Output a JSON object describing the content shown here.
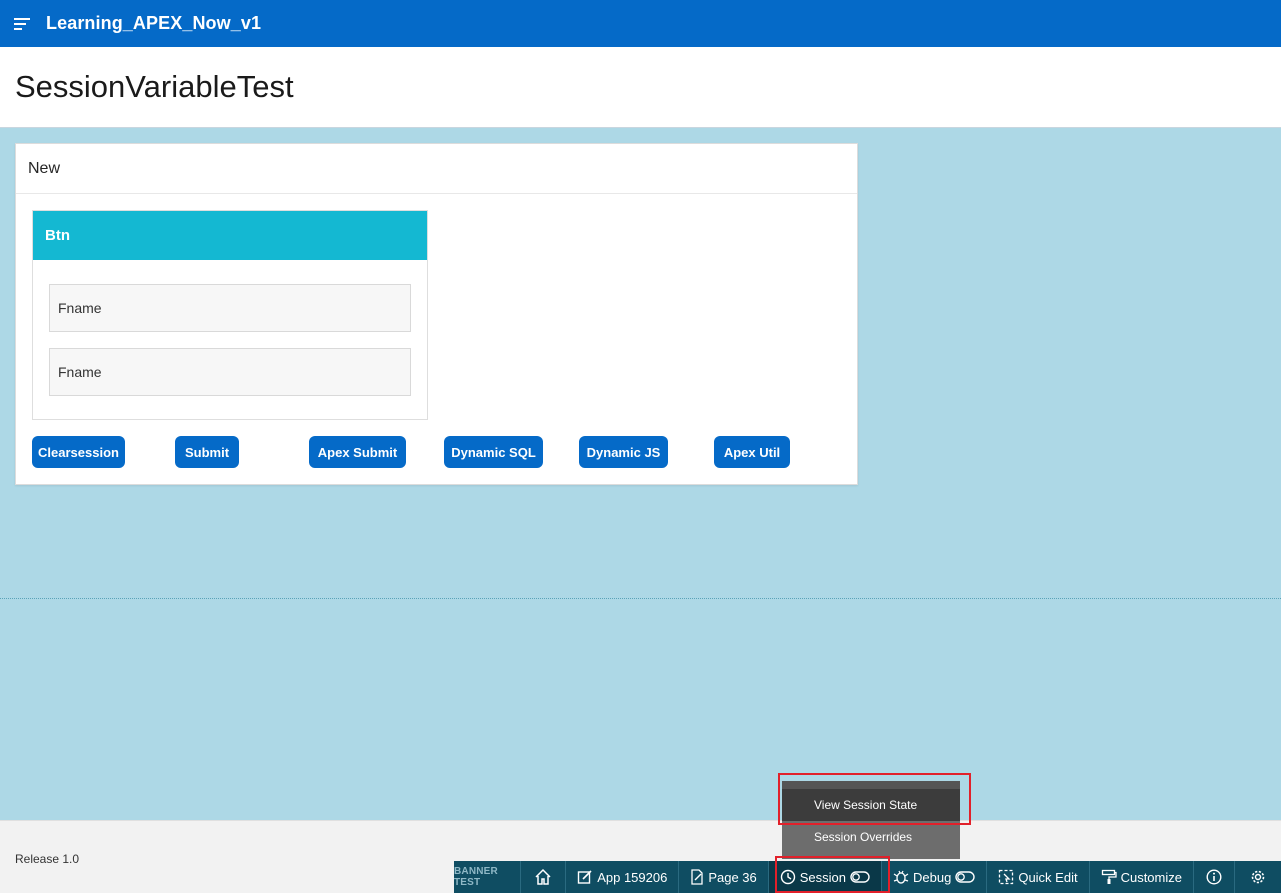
{
  "header": {
    "app_title": "Learning_APEX_Now_v1",
    "menu_icon": "hamburger-menu-icon"
  },
  "page": {
    "title": "SessionVariableTest"
  },
  "region": {
    "title": "New",
    "card": {
      "title": "Btn",
      "fields": [
        {
          "label": "Fname"
        },
        {
          "label": "Fname"
        }
      ]
    },
    "buttons": [
      "Clearsession",
      "Submit",
      "Apex Submit",
      "Dynamic SQL",
      "Dynamic JS",
      "Apex Util"
    ]
  },
  "footer": {
    "release": "Release 1.0"
  },
  "dev_toolbar": {
    "banner": "BANNER TEST",
    "home_icon": "home-icon",
    "app_label": "App 159206",
    "page_label": "Page 36",
    "session_label": "Session",
    "debug_label": "Debug",
    "quick_edit_label": "Quick Edit",
    "customize_label": "Customize",
    "info_icon": "info-icon",
    "settings_icon": "gear-icon"
  },
  "session_menu": {
    "items": [
      "View Session State",
      "Session Overrides"
    ]
  },
  "colors": {
    "accent": "#056ac8",
    "card_header": "#14b8d2",
    "background": "#add8e6",
    "devbar": "#0f4d62",
    "highlight": "#e2202a"
  }
}
